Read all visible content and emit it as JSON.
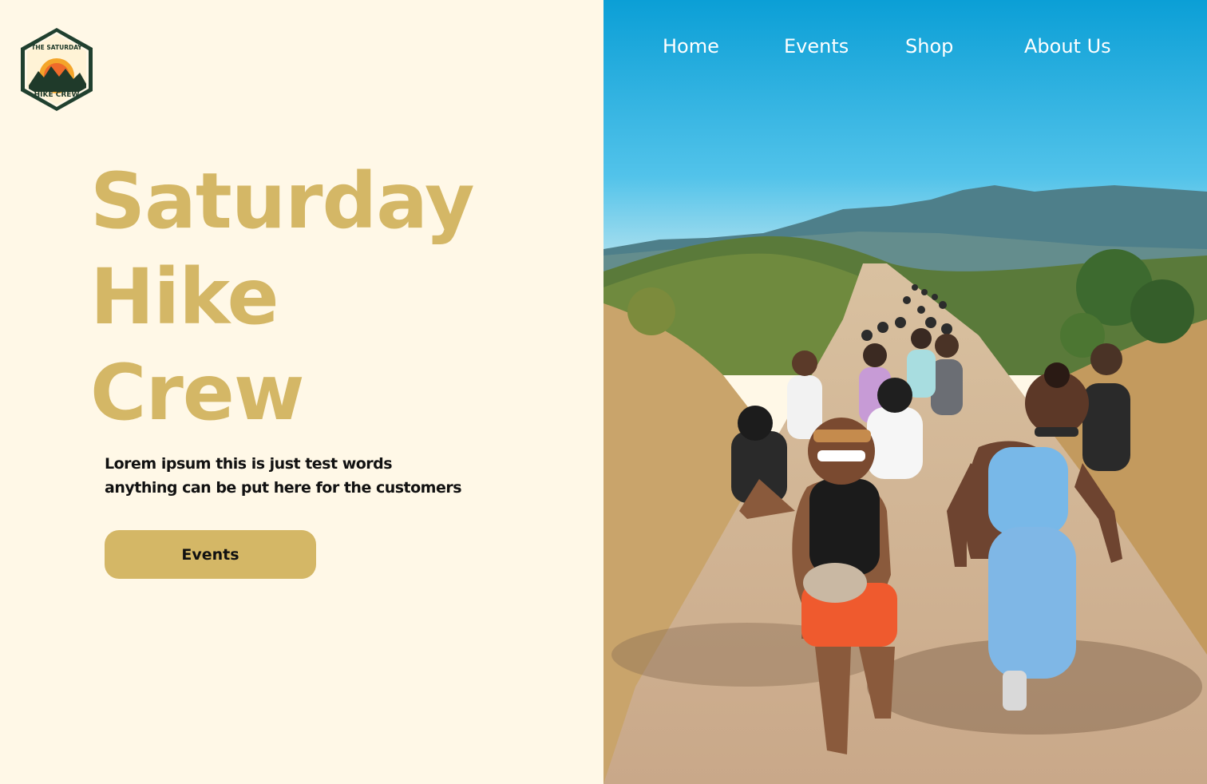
{
  "brand": {
    "logo_top_text": "THE SATURDAY",
    "logo_bottom_text": "HIKE CREW",
    "logo_icon": "mountain-sunset-badge"
  },
  "nav": {
    "home": "Home",
    "events": "Events",
    "shop": "Shop",
    "about": "About Us"
  },
  "hero": {
    "title_line1": "Saturday",
    "title_line2": "Hike",
    "title_line3": "Crew",
    "tagline_line1": "Lorem ipsum this is just test words",
    "tagline_line2": "anything can be put here for the customers",
    "cta_label": "Events",
    "photo": "group-hikers-on-mountain-trail"
  },
  "colors": {
    "background": "#fff8e7",
    "accent_gold": "#d4b766",
    "text_dark": "#111111",
    "nav_text": "#ffffff",
    "sky": "#1aa7d9"
  }
}
